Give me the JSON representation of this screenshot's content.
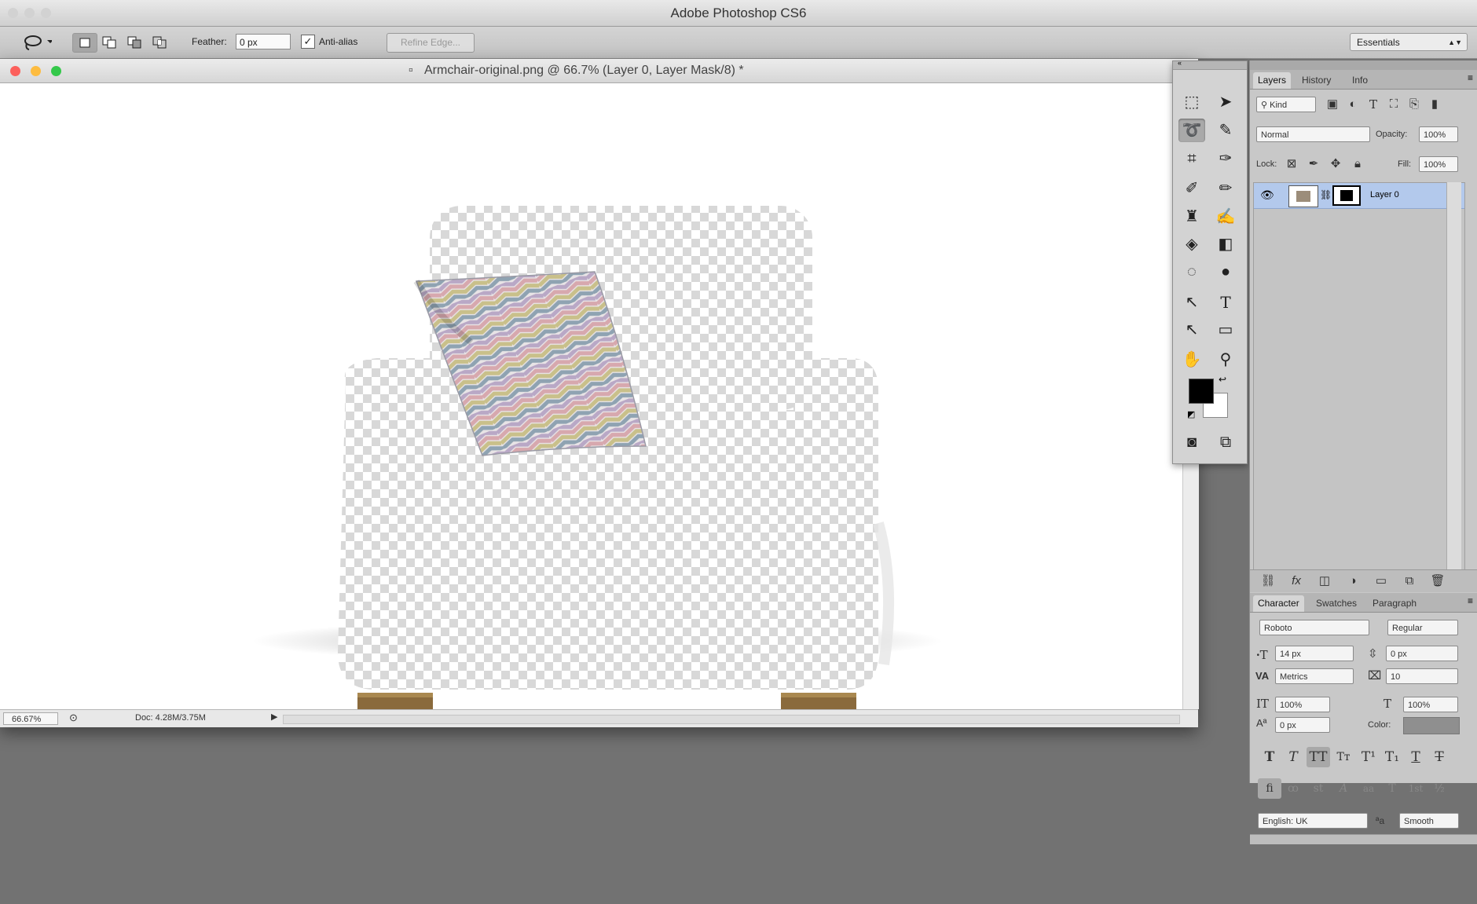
{
  "app": {
    "title": "Adobe Photoshop CS6"
  },
  "options_bar": {
    "feather_label": "Feather:",
    "feather_value": "0 px",
    "antialias_label": "Anti-alias",
    "antialias_checked": true,
    "refine_edge_label": "Refine Edge...",
    "workspace": "Essentials"
  },
  "document": {
    "title": "Armchair-original.png @ 66.7% (Layer 0, Layer Mask/8) *",
    "zoom": "66.67%",
    "doc_size": "Doc: 4.28M/3.75M"
  },
  "layers_panel": {
    "tabs": [
      "Layers",
      "History",
      "Info"
    ],
    "active_tab": "Layers",
    "filter": "Kind",
    "blend_mode": "Normal",
    "opacity_label": "Opacity:",
    "opacity": "100%",
    "lock_label": "Lock:",
    "fill_label": "Fill:",
    "fill": "100%",
    "layers": [
      {
        "name": "Layer 0",
        "visible": true,
        "selected": true
      }
    ]
  },
  "character_panel": {
    "tabs": [
      "Character",
      "Swatches",
      "Paragraph"
    ],
    "active_tab": "Character",
    "font_family": "Roboto",
    "font_style": "Regular",
    "font_size": "14 px",
    "leading": "0 px",
    "kerning": "Metrics",
    "tracking": "10",
    "vertical_scale": "100%",
    "horizontal_scale": "100%",
    "baseline_shift": "0 px",
    "color_label": "Color:",
    "language": "English: UK",
    "antialias_method": "Smooth",
    "type_buttons": [
      "T",
      "T",
      "TT",
      "Tт",
      "T¹",
      "T₁",
      "T",
      "T"
    ],
    "opentype_buttons": [
      "fi",
      "ꝏ",
      "st",
      "A",
      "aa",
      "T",
      "1st",
      "½"
    ]
  },
  "colors": {
    "foreground": "#000000",
    "background": "#ffffff",
    "selection_highlight": "#b3c9ec",
    "mac_close": "#fc605c",
    "mac_minimize": "#fdbc40",
    "mac_zoom": "#34c84a"
  },
  "icons": {
    "lasso": "lasso-icon",
    "layer_visibility": "eye-icon",
    "link": "chain-link-icon"
  }
}
